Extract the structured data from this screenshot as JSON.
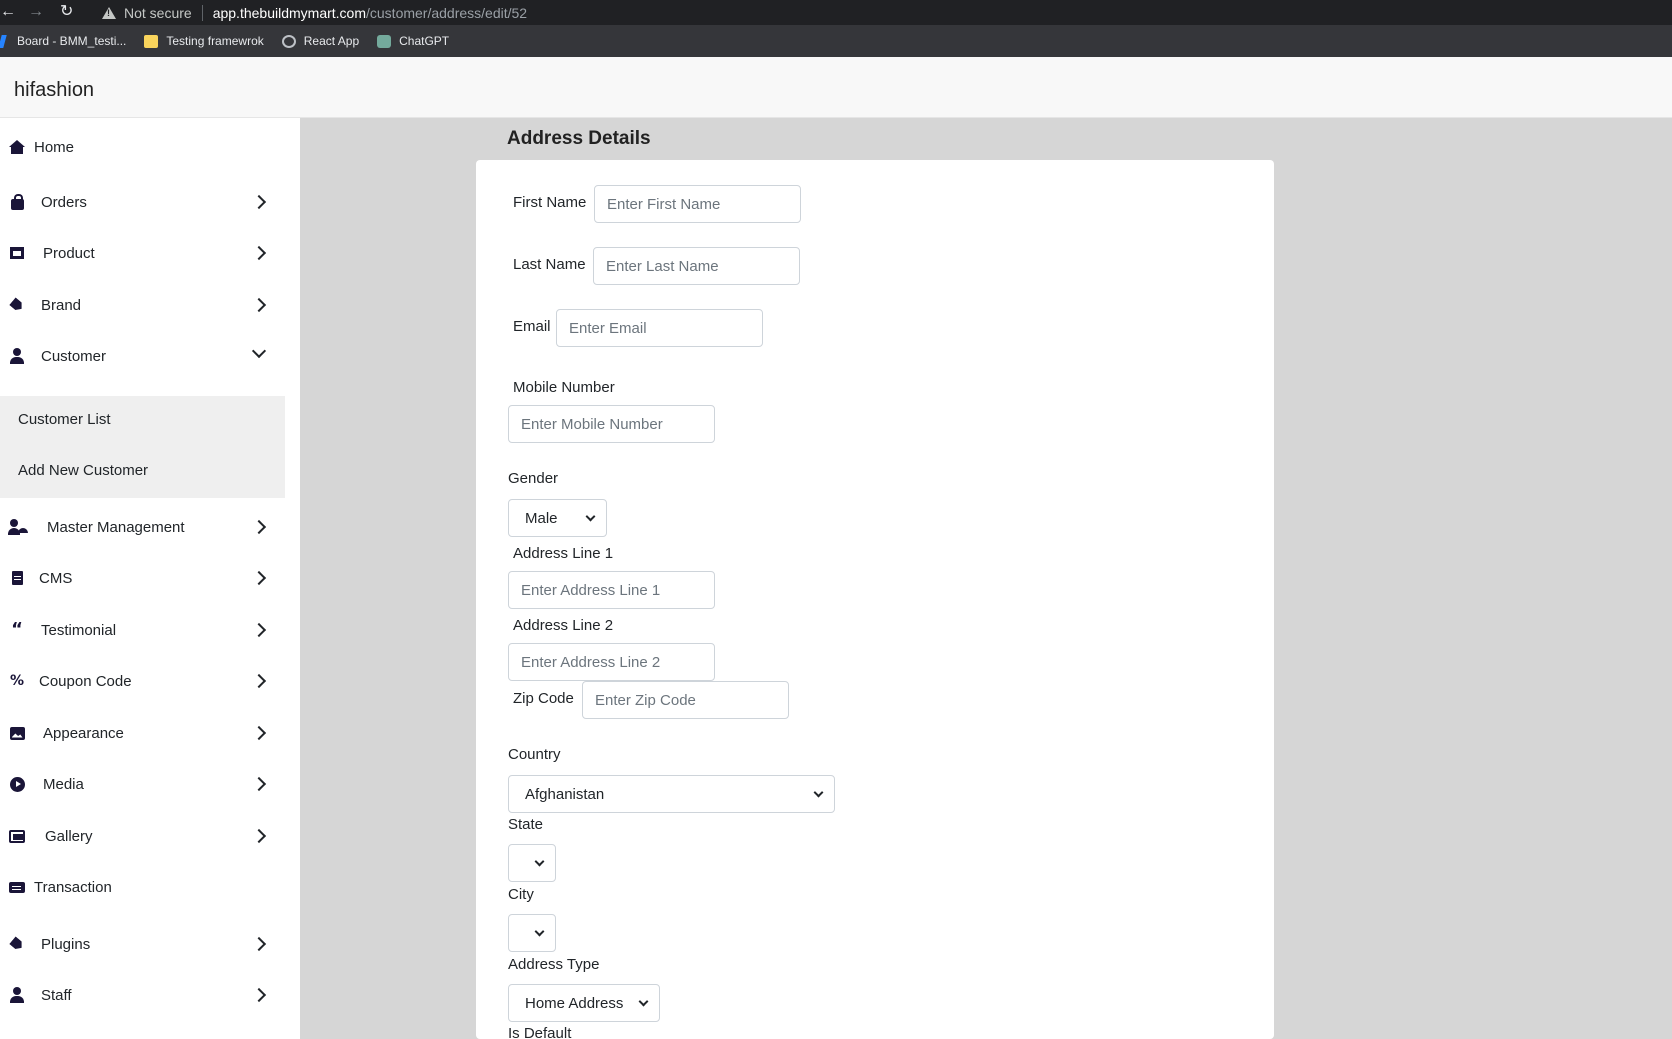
{
  "browser": {
    "security_label": "Not secure",
    "url_host": "app.thebuildmymart.com",
    "url_path": "/customer/address/edit/52",
    "bookmarks": [
      {
        "label": "Board - BMM_testi..."
      },
      {
        "label": "Testing framewrok"
      },
      {
        "label": "React App"
      },
      {
        "label": "ChatGPT"
      }
    ]
  },
  "app": {
    "brand": "hifashion"
  },
  "sidebar": {
    "items": [
      {
        "label": "Home",
        "icon": "home-icon"
      },
      {
        "label": "Orders",
        "icon": "shopping-bag-icon"
      },
      {
        "label": "Product",
        "icon": "archive-icon"
      },
      {
        "label": "Brand",
        "icon": "tags-icon"
      },
      {
        "label": "Customer",
        "icon": "user-icon"
      },
      {
        "label": "Master Management",
        "icon": "user-gear-icon"
      },
      {
        "label": "CMS",
        "icon": "file-icon"
      },
      {
        "label": "Testimonial",
        "icon": "quote-icon"
      },
      {
        "label": "Coupon Code",
        "icon": "percent-icon"
      },
      {
        "label": "Appearance",
        "icon": "image-icon"
      },
      {
        "label": "Media",
        "icon": "play-icon"
      },
      {
        "label": "Gallery",
        "icon": "images-icon"
      },
      {
        "label": "Transaction",
        "icon": "credit-card-icon"
      },
      {
        "label": "Plugins",
        "icon": "tag-icon"
      },
      {
        "label": "Staff",
        "icon": "user-icon"
      }
    ],
    "customer_sub": [
      {
        "label": "Customer List"
      },
      {
        "label": "Add New Customer"
      }
    ]
  },
  "form": {
    "title": "Address Details",
    "first_name": {
      "label": "First Name",
      "placeholder": "Enter First Name"
    },
    "last_name": {
      "label": "Last Name",
      "placeholder": "Enter Last Name"
    },
    "email": {
      "label": "Email",
      "placeholder": "Enter Email"
    },
    "mobile": {
      "label": "Mobile Number",
      "placeholder": "Enter Mobile Number"
    },
    "gender": {
      "label": "Gender",
      "value": "Male"
    },
    "address1": {
      "label": "Address Line 1",
      "placeholder": "Enter Address Line 1"
    },
    "address2": {
      "label": "Address Line 2",
      "placeholder": "Enter Address Line 2"
    },
    "zip": {
      "label": "Zip Code",
      "placeholder": "Enter Zip Code"
    },
    "country": {
      "label": "Country",
      "value": "Afghanistan"
    },
    "state": {
      "label": "State",
      "value": ""
    },
    "city": {
      "label": "City",
      "value": ""
    },
    "address_type": {
      "label": "Address Type",
      "value": "Home Address"
    },
    "is_default": {
      "label": "Is Default"
    }
  }
}
